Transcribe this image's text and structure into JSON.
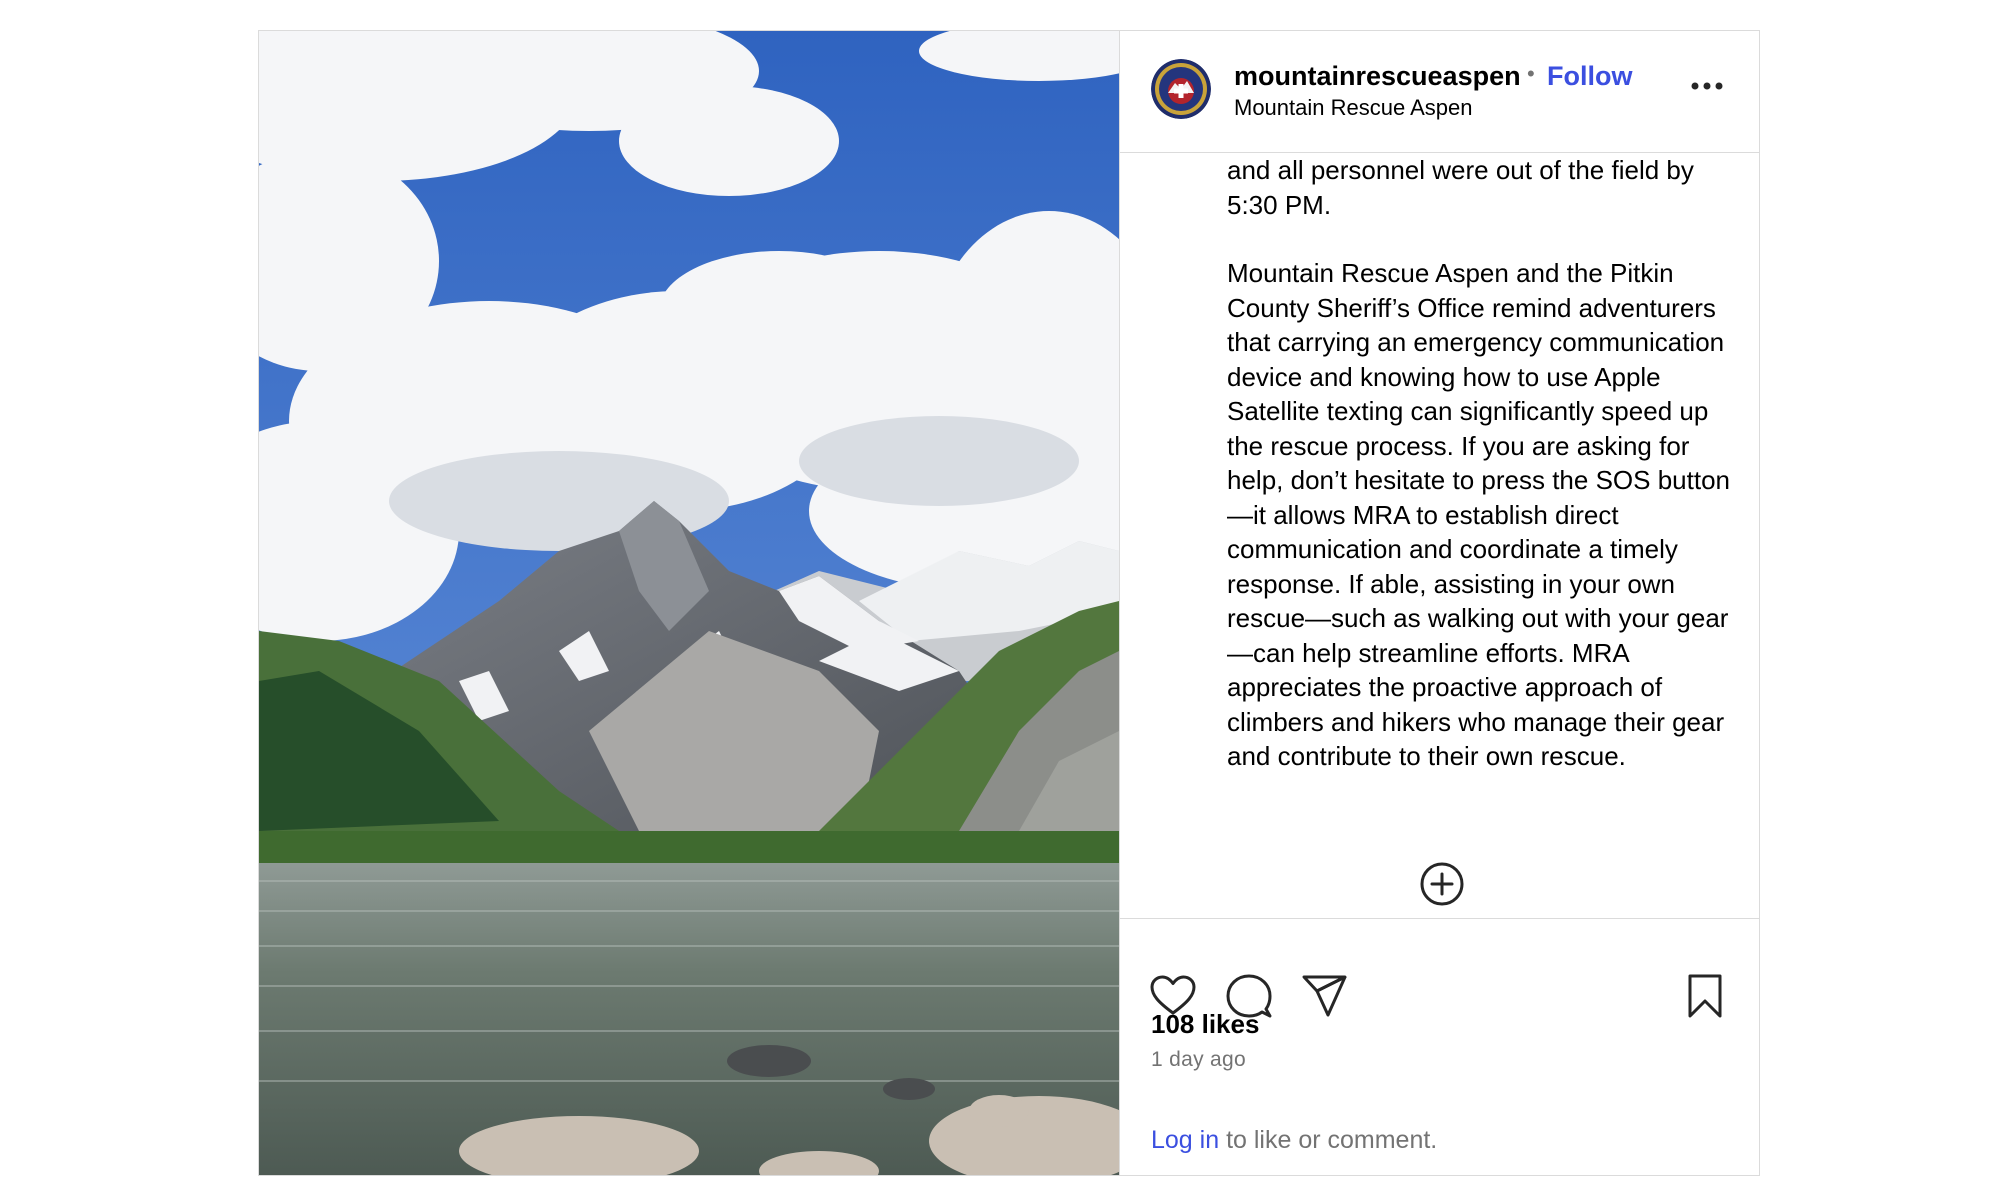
{
  "post": {
    "image_alt": "Mountain lake with a snowy peak under a blue sky with clouds",
    "author": {
      "username": "mountainrescueaspen",
      "display_name": "Mountain Rescue Aspen",
      "separator": "•",
      "follow_label": "Follow",
      "avatar_icon": "mra-logo-icon"
    },
    "caption": {
      "continuation": "and all personnel were out of the field by 5:30 PM.",
      "paragraph": "Mountain Rescue Aspen and the Pitkin County Sheriff’s Office remind adventurers that carrying an emergency communication device and knowing how to use Apple Satellite texting can significantly speed up the rescue process. If you are asking for help, don’t hesitate to press the SOS button—it allows MRA to establish direct communication and coordinate a timely response. If able, assisting in your own rescue—such as walking out with your gear—can help streamline efforts. MRA appreciates the proactive approach of climbers and hikers who manage their gear and contribute to their own rescue."
    },
    "likes": "108 likes",
    "timestamp": "1 day ago",
    "login": {
      "link_label": "Log in",
      "rest": " to like or comment."
    }
  },
  "icons": {
    "more": "more-options-icon",
    "load_more": "plus-circle-icon",
    "like": "heart-icon",
    "comment": "comment-icon",
    "share": "share-icon",
    "save": "bookmark-icon"
  },
  "colors": {
    "link": "#3b4fe0",
    "muted": "#737373",
    "border": "#dbdbdb"
  }
}
